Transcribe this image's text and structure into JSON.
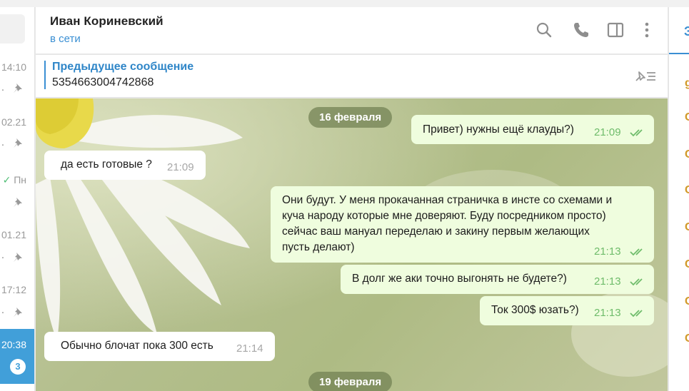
{
  "chat_list": {
    "rows": [
      {
        "time": "14:10",
        "sub": "."
      },
      {
        "time": "02.21",
        "sub": "."
      },
      {
        "time": "Пн",
        "sub": ""
      },
      {
        "time": "01.21",
        "sub": "."
      },
      {
        "time": "17:12",
        "sub": "."
      },
      {
        "time": "20:38",
        "sub": "",
        "badge": "3"
      }
    ]
  },
  "header": {
    "name": "Иван Кориневский",
    "status": "в сети",
    "icons": [
      "search-icon",
      "phone-icon",
      "sidebar-toggle-icon",
      "more-vertical-icon"
    ]
  },
  "pinned": {
    "title": "Предыдущее сообщение",
    "text": "5354663004742868",
    "icon": "pinned-list-icon"
  },
  "dates": [
    "16 февраля",
    "19 февраля"
  ],
  "messages": [
    {
      "dir": "out",
      "text": "Привет) нужны ещё клауды?)",
      "time": "21:09",
      "read": true
    },
    {
      "dir": "in",
      "text": "да есть готовые ?",
      "time": "21:09"
    },
    {
      "dir": "out",
      "lines": [
        "Они будут. У меня прокачанная страничка в инсте со схемами и",
        "куча народу которые мне доверяют. Буду посредником просто)",
        "сейчас ваш мануал переделаю и закину первым желающих",
        "пусть делают)"
      ],
      "time": "21:13",
      "read": true
    },
    {
      "dir": "out",
      "text": "В долг же аки точно выгонять не будете?)",
      "time": "21:13",
      "read": true
    },
    {
      "dir": "out",
      "text": "Ток 300$ юзать?)",
      "time": "21:13",
      "read": true
    },
    {
      "dir": "in",
      "text": "Обычно блочат пока 300 есть",
      "time": "21:14"
    }
  ],
  "right_panel": {
    "tab_char": "З",
    "glyphs": [
      "g",
      "C",
      "C",
      "C",
      "C",
      "C",
      "C",
      "C"
    ]
  },
  "colors": {
    "accent": "#3a8fd3",
    "outgoing_bubble": "#effdde",
    "incoming_bubble": "#ffffff",
    "read_check": "#6fbc6b",
    "active_chat": "#419fd9"
  }
}
